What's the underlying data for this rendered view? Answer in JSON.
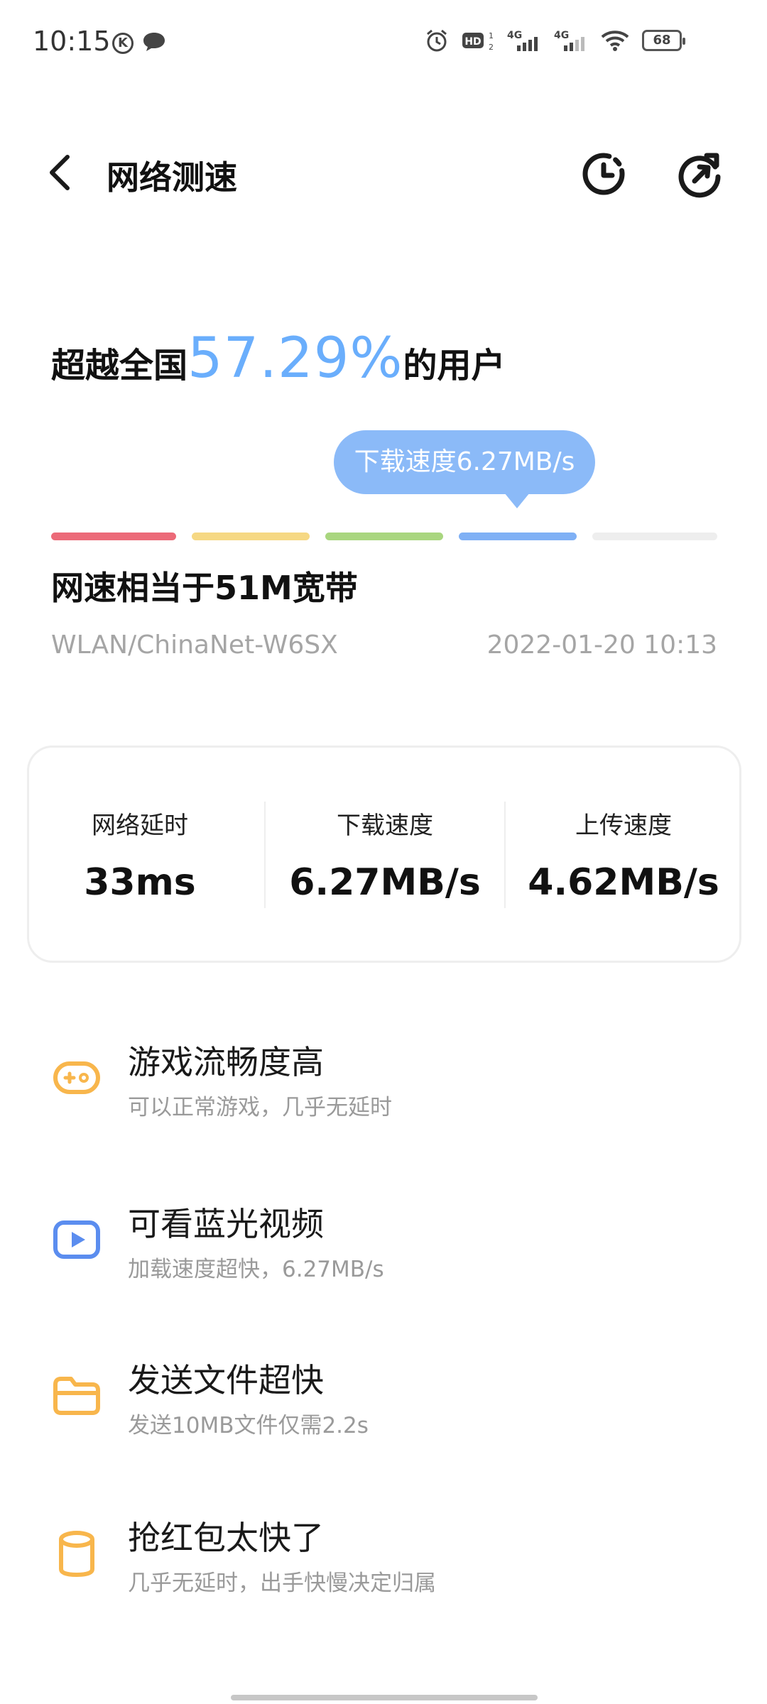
{
  "status_bar": {
    "time": "10:15",
    "battery_level": "68",
    "icons": [
      "k-icon",
      "message-icon",
      "alarm-icon",
      "hd-icon",
      "4g-signal-icon",
      "4g-signal-icon",
      "wifi-icon",
      "battery-icon"
    ]
  },
  "app_bar": {
    "title": "网络测速"
  },
  "result": {
    "prefix": "超越全国",
    "percent": "57.29%",
    "suffix": "的用户",
    "tooltip": "下载速度6.27MB/s",
    "bandwidth": "网速相当于51M宽带",
    "network": "WLAN/ChinaNet-W6SX",
    "timestamp": "2022-01-20 10:13",
    "scale_colors": [
      "#ec6a78",
      "#f6d883",
      "#a9d67f",
      "#7fb0f5",
      "#eeeeee"
    ],
    "active_level": 4
  },
  "metrics": [
    {
      "label": "网络延时",
      "value": "33ms"
    },
    {
      "label": "下载速度",
      "value": "6.27MB/s"
    },
    {
      "label": "上传速度",
      "value": "4.62MB/s"
    }
  ],
  "features": [
    {
      "icon": "gamepad-icon",
      "title": "游戏流畅度高",
      "subtitle": "可以正常游戏，几乎无延时"
    },
    {
      "icon": "video-play-icon",
      "title": "可看蓝光视频",
      "subtitle": "加载速度超快，6.27MB/s"
    },
    {
      "icon": "folder-icon",
      "title": "发送文件超快",
      "subtitle": "发送10MB文件仅需2.2s"
    },
    {
      "icon": "red-packet-icon",
      "title": "抢红包太快了",
      "subtitle": "几乎无延时，出手快慢决定归属"
    }
  ],
  "colors": {
    "accent": "#6aaefc",
    "tooltip": "#8bbaf8",
    "game": "#f8b64c",
    "video": "#5b8def",
    "folder": "#f8b64c",
    "packet": "#f8b64c"
  }
}
